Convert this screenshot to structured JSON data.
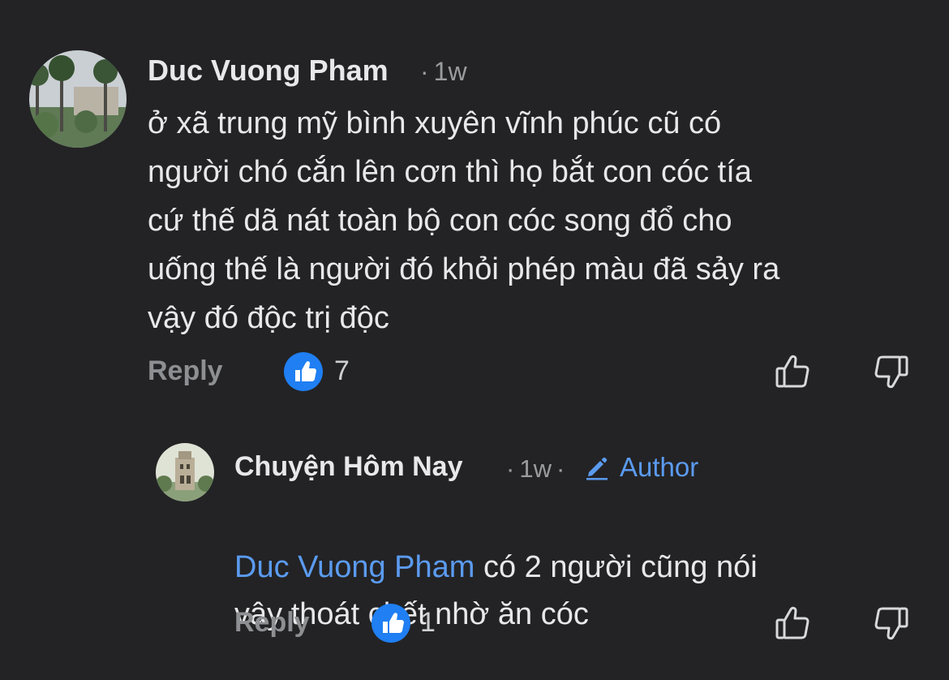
{
  "comment": {
    "author": "Duc Vuong Pham",
    "time": "1w",
    "text": "ở xã trung mỹ bình xuyên vĩnh phúc cũ có\nngười chó cắn lên cơn thì họ bắt con cóc tía\ncứ thế dã nát toàn bộ con cóc song đổ cho\nuống thế là người đó khỏi phép màu đã sảy ra\nvậy đó độc trị độc",
    "reply_label": "Reply",
    "like_count": "7",
    "avatar_icon": "avatar-photo-trees"
  },
  "reply": {
    "author": "Chuyện Hôm Nay",
    "time": "1w",
    "badge_label": "Author",
    "badge_icon": "pencil-icon",
    "mention": "Duc Vuong Pham",
    "text_line1": " có 2 người cũng nói",
    "text_line2": "vậy thoát chết nhờ ăn cóc",
    "reply_label": "Reply",
    "like_count": "1",
    "avatar_icon": "avatar-photo-tower"
  },
  "colors": {
    "background": "#232325",
    "accent": "#5b9bf0",
    "like_badge": "#1f7ff3",
    "muted": "#9b9ca0"
  }
}
